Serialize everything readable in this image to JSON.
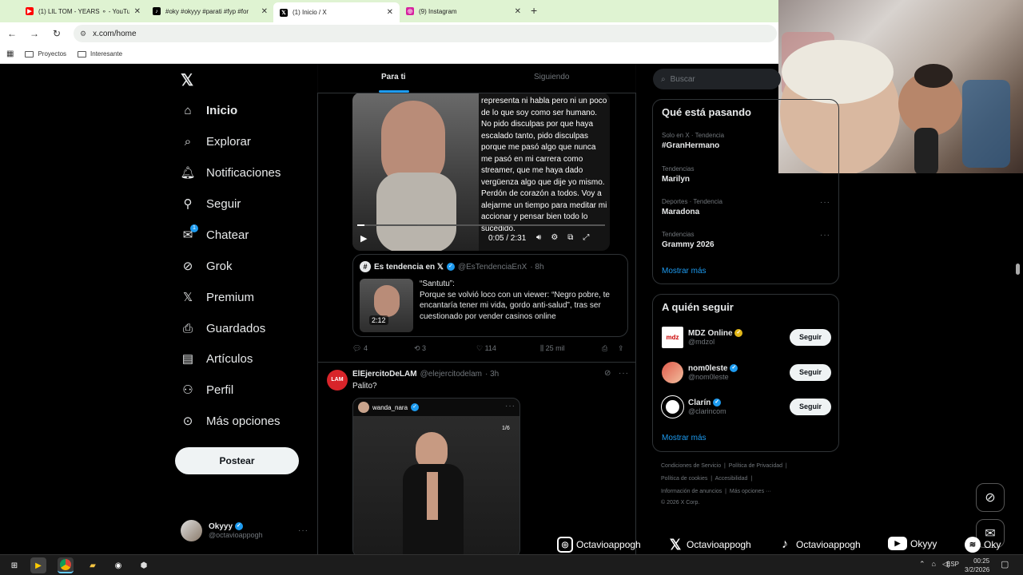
{
  "browser": {
    "tabs": [
      {
        "title": "(1) LIL TOM - YEARS ⚬ - YouTu",
        "icon": "youtube-icon",
        "color": "#ff0000"
      },
      {
        "title": "#oky #okyyy #parati #fyp #for",
        "icon": "tiktok-icon",
        "color": "#000000"
      },
      {
        "title": "(1) Inicio / X",
        "icon": "x-icon",
        "color": "#000000"
      },
      {
        "title": "(9) Instagram",
        "icon": "instagram-icon",
        "color": "#d6249f"
      }
    ],
    "url": "x.com/home",
    "bookmarks": [
      "Proyectos",
      "Interesante"
    ]
  },
  "nav": {
    "items": [
      {
        "label": "Inicio",
        "icon": "home-icon"
      },
      {
        "label": "Explorar",
        "icon": "search-icon"
      },
      {
        "label": "Notificaciones",
        "icon": "bell-icon"
      },
      {
        "label": "Seguir",
        "icon": "follow-icon"
      },
      {
        "label": "Chatear",
        "icon": "mail-icon",
        "badge": "1"
      },
      {
        "label": "Grok",
        "icon": "grok-icon"
      },
      {
        "label": "Premium",
        "icon": "x-icon"
      },
      {
        "label": "Guardados",
        "icon": "bookmark-icon"
      },
      {
        "label": "Artículos",
        "icon": "article-icon"
      },
      {
        "label": "Perfil",
        "icon": "profile-icon"
      },
      {
        "label": "Más opciones",
        "icon": "more-icon"
      }
    ],
    "post_label": "Postear",
    "account": {
      "name": "Okyyy",
      "handle": "@octavioappogh"
    }
  },
  "feed": {
    "tabs": [
      "Para ti",
      "Siguiendo"
    ],
    "video_text": "representa ni habla pero ni un poco de lo que soy como ser humano. No pido disculpas por que haya escalado tanto, pido disculpas porque me pasó algo que nunca me pasó en mi carrera como streamer, que me haya dado vergüenza algo que dije yo mismo. Perdón de corazón a todos. Voy a alejarme un tiempo para meditar mi accionar y pensar bien todo lo sucedido.",
    "video_time": "0:05 / 2:31",
    "quote": {
      "name": "Es tendencia en 𝕏",
      "handle": "@EsTendenciaEnX",
      "time": "· 8h",
      "duration": "2:12",
      "title": "“Santutu”:",
      "text": "Porque se volvió loco con un viewer: “Negro pobre, te encantaría tener mi vida, gordo anti-salud”, tras ser cuestionado por vender casinos online"
    },
    "stats": {
      "replies": "4",
      "reposts": "3",
      "likes": "114",
      "views": "25 mil"
    },
    "post2": {
      "name": "ElEjercitoDeLAM",
      "handle": "@elejercitodelam",
      "time": "· 3h",
      "avatar_text": "LAM",
      "text": "Palito?",
      "embed_user": "wanda_nara",
      "embed_count": "1/6"
    }
  },
  "right": {
    "search_placeholder": "Buscar",
    "trends_title": "Qué está pasando",
    "trends": [
      {
        "context": "Solo en X · Tendencia",
        "name": "#GranHermano"
      },
      {
        "context": "Tendencias",
        "name": "Marilyn"
      },
      {
        "context": "Deportes · Tendencia",
        "name": "Maradona"
      },
      {
        "context": "Tendencias",
        "name": "Grammy 2026"
      }
    ],
    "show_more": "Mostrar más",
    "follow_title": "A quién seguir",
    "follow": [
      {
        "name": "MDZ Online",
        "handle": "@mdzol",
        "avatar_text": "mdz",
        "badge": "gold"
      },
      {
        "name": "nom0leste",
        "handle": "@nom0leste",
        "avatar_text": "",
        "badge": "blue"
      },
      {
        "name": "Clarín",
        "handle": "@clarincom",
        "avatar_text": "",
        "badge": "blue"
      }
    ],
    "follow_button": "Seguir",
    "show_more2": "Mostrar más",
    "footer": {
      "l1a": "Condiciones de Servicio",
      "l1b": "Política de Privacidad",
      "l2a": "Política de cookies",
      "l2b": "Accesibilidad",
      "l3a": "Información de anuncios",
      "l3b": "Más opciones ···",
      "copy": "© 2026 X Corp."
    }
  },
  "overlay": {
    "socials": [
      {
        "platform": "instagram-icon",
        "handle": "Octavioappogh"
      },
      {
        "platform": "x-icon",
        "handle": "Octavioappogh"
      },
      {
        "platform": "tiktok-icon",
        "handle": "Octavioappogh"
      },
      {
        "platform": "youtube-icon",
        "handle": "Okyyy"
      },
      {
        "platform": "spotify-icon",
        "handle": "Oky"
      }
    ]
  },
  "taskbar": {
    "lang": "ESP",
    "time": "00:25",
    "date": "3/2/2026"
  }
}
